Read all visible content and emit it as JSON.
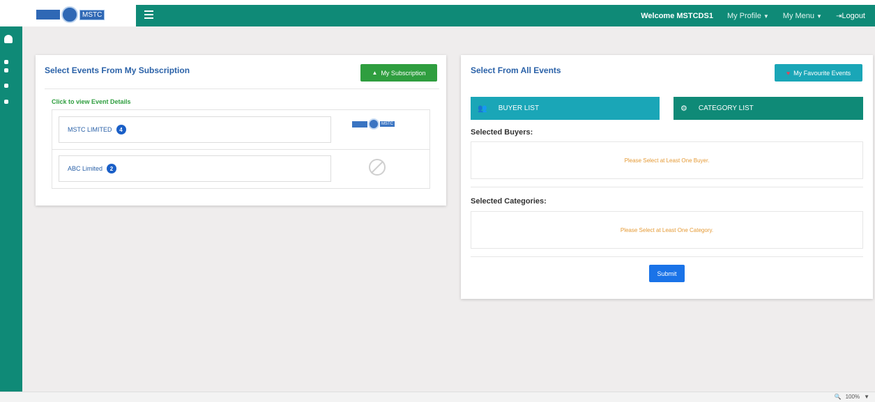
{
  "header": {
    "logo_text": "MSTC",
    "welcome": "Welcome MSTCDS1",
    "menu": [
      {
        "label": "My Profile",
        "caret": "▼"
      },
      {
        "label": "My Menu",
        "caret": "▼"
      }
    ],
    "logout": "Logout",
    "logout_icon": "sign-out-icon"
  },
  "left_card": {
    "title": "Select Events From My Subscription",
    "subscription_button": "My Subscription",
    "subscription_icon": "bell-icon",
    "click_label": "Click to view Event Details",
    "events": [
      {
        "name": "MSTC LIMITED",
        "count": "4",
        "logo": "mstc-logo"
      },
      {
        "name": "ABC Limited",
        "count": "2",
        "logo": "no-logo"
      }
    ],
    "logo_text": "MSTC"
  },
  "right_card": {
    "title": "Select From All Events",
    "favourite_button": "My Favourite Events",
    "favourite_icon": "heart-icon",
    "buyer_list": "BUYER LIST",
    "buyer_icon": "users-icon",
    "category_list": "CATEGORY LIST",
    "category_icon": "cogs-icon",
    "selected_buyers_label": "Selected Buyers:",
    "buyers_message": "Please Select at Least One Buyer.",
    "selected_categories_label": "Selected Categories:",
    "categories_message": "Please Select at Least One Category.",
    "submit": "Submit"
  },
  "statusbar": {
    "zoom": "100%",
    "zoom_icon": "magnifier-icon",
    "caret": "▼"
  },
  "colors": {
    "brand_green": "#0f8a77",
    "teal": "#1aa6b7",
    "button_green": "#2f9e3f",
    "title_blue": "#2b62a8",
    "message_orange": "#e59a35",
    "submit_blue": "#1a73e8"
  }
}
